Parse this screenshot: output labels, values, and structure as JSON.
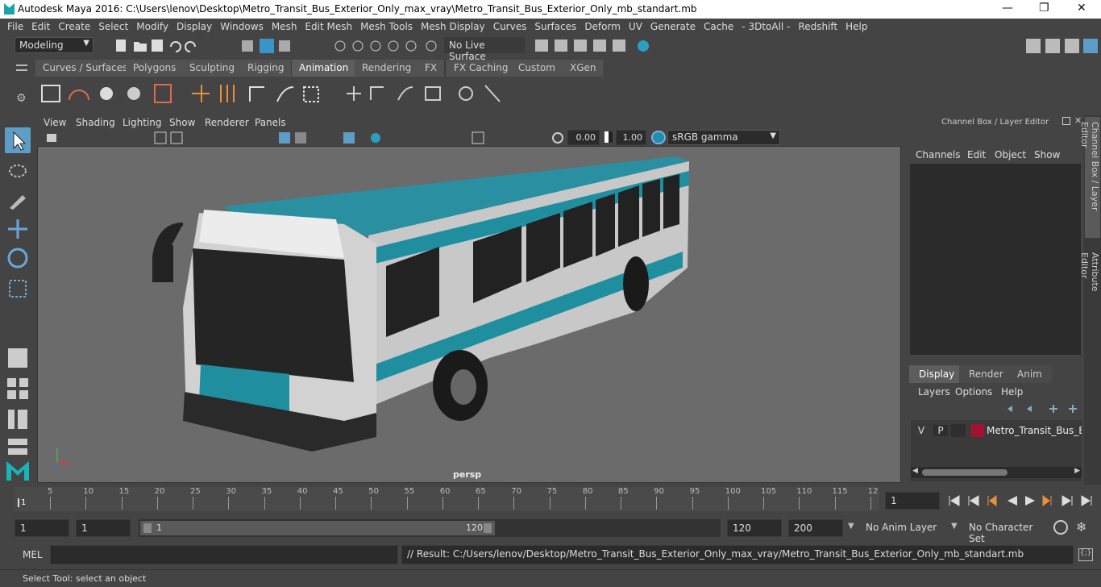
{
  "window": {
    "title": "Autodesk Maya 2016: C:\\Users\\lenov\\Desktop\\Metro_Transit_Bus_Exterior_Only_max_vray\\Metro_Transit_Bus_Exterior_Only_mb_standart.mb"
  },
  "menu": [
    "File",
    "Edit",
    "Create",
    "Select",
    "Modify",
    "Display",
    "Windows",
    "Mesh",
    "Edit Mesh",
    "Mesh Tools",
    "Mesh Display",
    "Curves",
    "Surfaces",
    "Deform",
    "UV",
    "Generate",
    "Cache",
    "- 3DtoAll -",
    "Redshift",
    "Help"
  ],
  "status_line": {
    "mode": "Modeling",
    "live_surface": "No Live Surface"
  },
  "shelf_tabs": [
    "Curves / Surfaces",
    "Polygons",
    "Sculpting",
    "Rigging",
    "Animation",
    "Rendering",
    "FX",
    "FX Caching",
    "Custom",
    "XGen"
  ],
  "active_shelf_tab": "Animation",
  "viewport": {
    "menu": [
      "View",
      "Shading",
      "Lighting",
      "Show",
      "Renderer",
      "Panels"
    ],
    "exposure": "0.00",
    "gamma": "1.00",
    "color_space": "sRGB gamma",
    "camera_label": "persp"
  },
  "channel_box": {
    "title": "Channel Box / Layer Editor",
    "menu": [
      "Channels",
      "Edit",
      "Object",
      "Show"
    ],
    "layer_tabs": [
      "Display",
      "Render",
      "Anim"
    ],
    "active_layer_tab": "Display",
    "layer_menu": [
      "Layers",
      "Options",
      "Help"
    ],
    "layer": {
      "v": "V",
      "p": "P",
      "name": "Metro_Transit_Bus_Ext",
      "color": "#a3122e"
    }
  },
  "side_tabs": [
    "Channel Box / Layer Editor",
    "Attribute Editor"
  ],
  "time_slider": {
    "ticks": [
      "5",
      "10",
      "15",
      "20",
      "25",
      "30",
      "35",
      "40",
      "45",
      "50",
      "55",
      "60",
      "65",
      "70",
      "75",
      "80",
      "85",
      "90",
      "95",
      "100",
      "105",
      "110",
      "115",
      "12"
    ],
    "start_marker": "1",
    "current_frame": "1"
  },
  "range_slider": {
    "start": "1",
    "playback_start": "1",
    "range_start": "1",
    "range_end": "120",
    "playback_end": "120",
    "end": "200",
    "anim_layer": "No Anim Layer",
    "character_set": "No Character Set"
  },
  "command_line": {
    "mode": "MEL",
    "result": "// Result: C:/Users/lenov/Desktop/Metro_Transit_Bus_Exterior_Only_max_vray/Metro_Transit_Bus_Exterior_Only_mb_standart.mb"
  },
  "help_line": "Select Tool: select an object",
  "colors": {
    "bus_teal": "#1f8fa0",
    "bus_body": "#c9c9c9",
    "accent": "#5d9ec7"
  }
}
